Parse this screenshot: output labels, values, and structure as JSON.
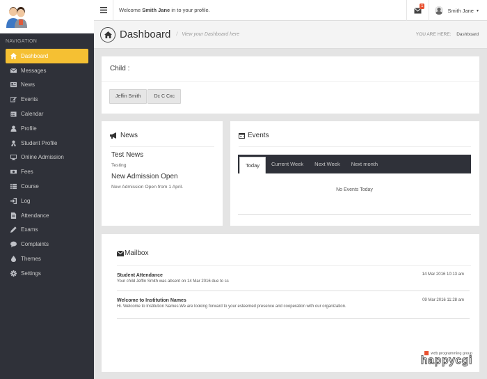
{
  "sidebar": {
    "header": "NAVIGATION",
    "items": [
      {
        "label": "Dashboard",
        "icon": "home-icon",
        "active": true
      },
      {
        "label": "Messages",
        "icon": "envelope-icon"
      },
      {
        "label": "News",
        "icon": "newspaper-icon"
      },
      {
        "label": "Events",
        "icon": "edit-icon"
      },
      {
        "label": "Calendar",
        "icon": "calendar-icon"
      },
      {
        "label": "Profile",
        "icon": "user-icon"
      },
      {
        "label": "Student Profile",
        "icon": "student-icon"
      },
      {
        "label": "Online Admission",
        "icon": "desktop-icon"
      },
      {
        "label": "Fees",
        "icon": "money-icon"
      },
      {
        "label": "Course",
        "icon": "list-icon"
      },
      {
        "label": "Log",
        "icon": "signin-icon"
      },
      {
        "label": "Attendance",
        "icon": "file-icon"
      },
      {
        "label": "Exams",
        "icon": "pencil-icon"
      },
      {
        "label": "Complaints",
        "icon": "comment-icon"
      },
      {
        "label": "Themes",
        "icon": "tint-icon"
      },
      {
        "label": "Settings",
        "icon": "gear-icon"
      }
    ]
  },
  "topbar": {
    "welcome_pre": "Welcome ",
    "user_name": "Smith Jane",
    "welcome_post": " in to your profile.",
    "mail_badge": "1",
    "account_name": "Smith Jane"
  },
  "pagehead": {
    "title": "Dashboard",
    "subtitle": "View your Dashboard here",
    "you_are_here": "YOU ARE HERE:",
    "current": "Dashboard"
  },
  "child": {
    "title": "Child :",
    "buttons": [
      "Jeffin Smith",
      "Dc C Cxc"
    ]
  },
  "news": {
    "title": "News",
    "items": [
      {
        "title": "Test News",
        "desc": "Testing"
      },
      {
        "title": "New Admission Open",
        "desc": "New Admission Open from 1 April."
      }
    ]
  },
  "events": {
    "title": "Events",
    "tabs": [
      "Today",
      "Current Week",
      "Next Week",
      "Next month"
    ],
    "empty": "No Events Today"
  },
  "mailbox": {
    "title": "Mailbox",
    "messages": [
      {
        "subject": "Student Attendance",
        "body": "Your child Jeffin Smith was absent on 14 Mar 2016 due to ss",
        "date": "14 Mar 2016 10:13 am"
      },
      {
        "subject": "Welcome to Institution Names",
        "body": "Hi. Welcome to Institution Names.We are looking forward to your esteemed presence and cooperation with our organization.",
        "date": "09 Mar 2016 11:28 am"
      }
    ]
  },
  "watermark": {
    "small": "web programming group",
    "big": "happycgi"
  },
  "colors": {
    "accent": "#f5c033",
    "sidebar": "#2f3139",
    "badge": "#e8502f"
  }
}
